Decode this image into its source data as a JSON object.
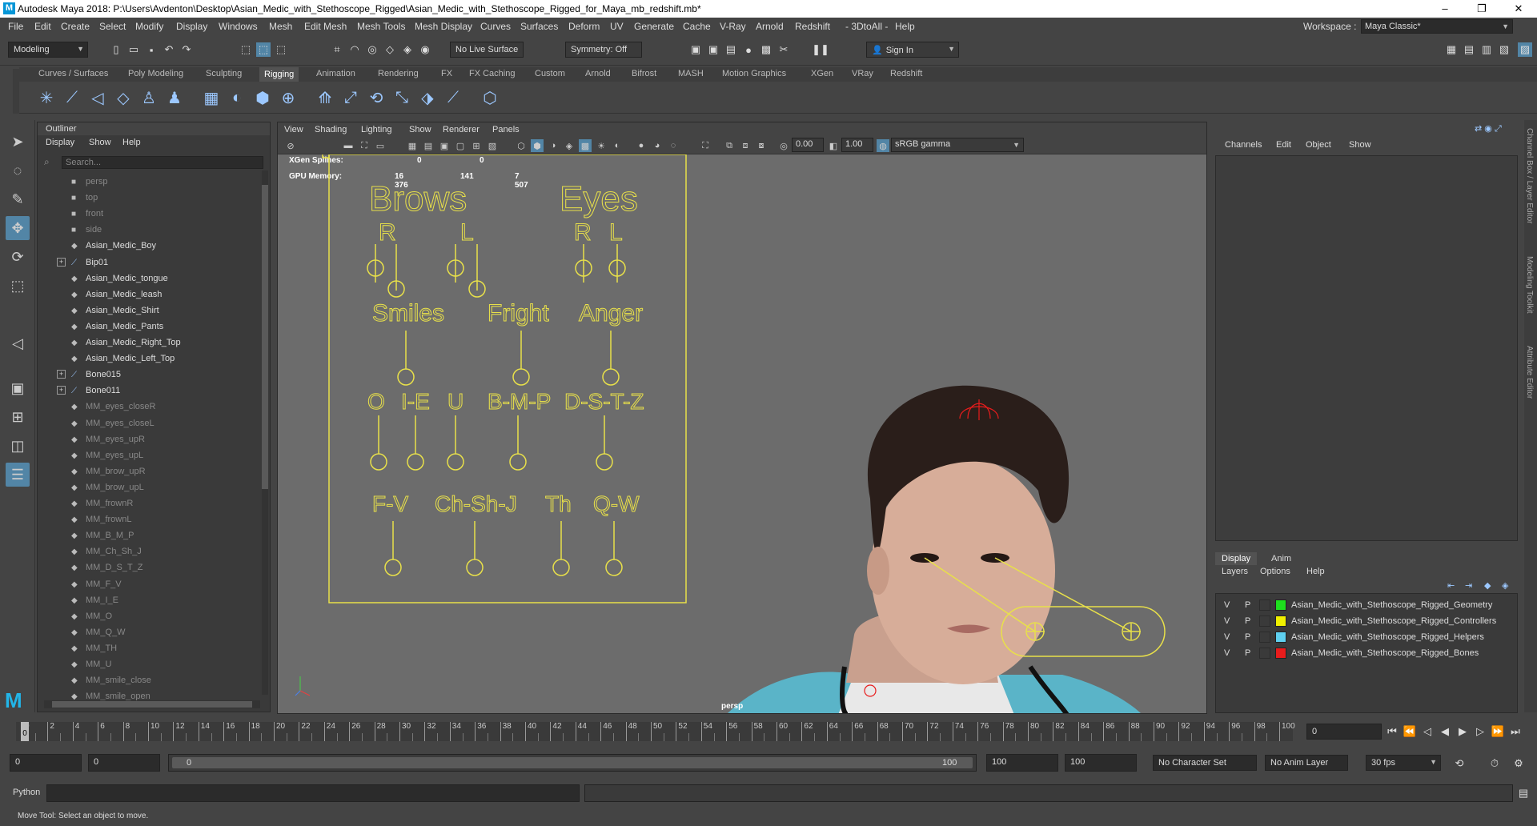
{
  "window": {
    "title": "Autodesk Maya 2018: P:\\Users\\Avdenton\\Desktop\\Asian_Medic_with_Stethoscope_Rigged\\Asian_Medic_with_Stethoscope_Rigged_for_Maya_mb_redshift.mb*",
    "logo": "M",
    "minimize": "–",
    "maximize": "❐",
    "close": "✕"
  },
  "menubar": [
    "File",
    "Edit",
    "Create",
    "Select",
    "Modify",
    "Display",
    "Windows",
    "Mesh",
    "Edit Mesh",
    "Mesh Tools",
    "Mesh Display",
    "Curves",
    "Surfaces",
    "Deform",
    "UV",
    "Generate",
    "Cache",
    "V-Ray",
    "Arnold",
    "Redshift",
    "- 3DtoAll -",
    "Help"
  ],
  "workspace": {
    "label": "Workspace :",
    "value": "Maya Classic*"
  },
  "status": {
    "mode": "Modeling",
    "live_surface": "No Live Surface",
    "symmetry": "Symmetry: Off",
    "sign_in": "Sign In"
  },
  "shelf_tabs": [
    "Curves / Surfaces",
    "Poly Modeling",
    "Sculpting",
    "Rigging",
    "Animation",
    "Rendering",
    "FX",
    "FX Caching",
    "Custom",
    "Arnold",
    "Bifrost",
    "MASH",
    "Motion Graphics",
    "XGen",
    "VRay",
    "Redshift"
  ],
  "shelf_active": "Rigging",
  "outliner": {
    "title": "Outliner",
    "menu": [
      "Display",
      "Show",
      "Help"
    ],
    "search_placeholder": "Search...",
    "items": [
      {
        "label": "persp",
        "icon": "camera-icon",
        "dim": true,
        "exp": false
      },
      {
        "label": "top",
        "icon": "camera-icon",
        "dim": true,
        "exp": false
      },
      {
        "label": "front",
        "icon": "camera-icon",
        "dim": true,
        "exp": false
      },
      {
        "label": "side",
        "icon": "camera-icon",
        "dim": true,
        "exp": false
      },
      {
        "label": "Asian_Medic_Boy",
        "icon": "mesh-icon",
        "dim": false,
        "exp": false
      },
      {
        "label": "Bip01",
        "icon": "joint-icon",
        "dim": false,
        "exp": true
      },
      {
        "label": "Asian_Medic_tongue",
        "icon": "mesh-icon",
        "dim": false,
        "exp": false
      },
      {
        "label": "Asian_Medic_leash",
        "icon": "mesh-icon",
        "dim": false,
        "exp": false
      },
      {
        "label": "Asian_Medic_Shirt",
        "icon": "mesh-icon",
        "dim": false,
        "exp": false
      },
      {
        "label": "Asian_Medic_Pants",
        "icon": "mesh-icon",
        "dim": false,
        "exp": false
      },
      {
        "label": "Asian_Medic_Right_Top",
        "icon": "mesh-icon",
        "dim": false,
        "exp": false
      },
      {
        "label": "Asian_Medic_Left_Top",
        "icon": "mesh-icon",
        "dim": false,
        "exp": false
      },
      {
        "label": "Bone015",
        "icon": "joint-icon",
        "dim": false,
        "exp": true
      },
      {
        "label": "Bone011",
        "icon": "joint-icon",
        "dim": false,
        "exp": true
      },
      {
        "label": "MM_eyes_closeR",
        "icon": "mesh-icon",
        "dim": true,
        "exp": false
      },
      {
        "label": "MM_eyes_closeL",
        "icon": "mesh-icon",
        "dim": true,
        "exp": false
      },
      {
        "label": "MM_eyes_upR",
        "icon": "mesh-icon",
        "dim": true,
        "exp": false
      },
      {
        "label": "MM_eyes_upL",
        "icon": "mesh-icon",
        "dim": true,
        "exp": false
      },
      {
        "label": "MM_brow_upR",
        "icon": "mesh-icon",
        "dim": true,
        "exp": false
      },
      {
        "label": "MM_brow_upL",
        "icon": "mesh-icon",
        "dim": true,
        "exp": false
      },
      {
        "label": "MM_frownR",
        "icon": "mesh-icon",
        "dim": true,
        "exp": false
      },
      {
        "label": "MM_frownL",
        "icon": "mesh-icon",
        "dim": true,
        "exp": false
      },
      {
        "label": "MM_B_M_P",
        "icon": "mesh-icon",
        "dim": true,
        "exp": false
      },
      {
        "label": "MM_Ch_Sh_J",
        "icon": "mesh-icon",
        "dim": true,
        "exp": false
      },
      {
        "label": "MM_D_S_T_Z",
        "icon": "mesh-icon",
        "dim": true,
        "exp": false
      },
      {
        "label": "MM_F_V",
        "icon": "mesh-icon",
        "dim": true,
        "exp": false
      },
      {
        "label": "MM_I_E",
        "icon": "mesh-icon",
        "dim": true,
        "exp": false
      },
      {
        "label": "MM_O",
        "icon": "mesh-icon",
        "dim": true,
        "exp": false
      },
      {
        "label": "MM_Q_W",
        "icon": "mesh-icon",
        "dim": true,
        "exp": false
      },
      {
        "label": "MM_TH",
        "icon": "mesh-icon",
        "dim": true,
        "exp": false
      },
      {
        "label": "MM_U",
        "icon": "mesh-icon",
        "dim": true,
        "exp": false
      },
      {
        "label": "MM_smile_close",
        "icon": "mesh-icon",
        "dim": true,
        "exp": false
      },
      {
        "label": "MM_smile_open",
        "icon": "mesh-icon",
        "dim": true,
        "exp": false
      }
    ]
  },
  "viewport": {
    "menu": [
      "View",
      "Shading",
      "Lighting",
      "Show",
      "Renderer",
      "Panels"
    ],
    "exposure": "0.00",
    "gamma": "1.00",
    "colorspace": "sRGB gamma",
    "hud": {
      "xgen_label": "XGen Splines:",
      "xgen_values": [
        "0",
        "0"
      ],
      "gpu_label": "GPU Memory:",
      "gpu_values": [
        "16 376",
        "141",
        "7 507"
      ]
    },
    "camera_label": "persp",
    "face_board": {
      "brows": "Brows",
      "eyes": "Eyes",
      "r": "R",
      "l": "L",
      "smiles": "Smiles",
      "fright": "Fright",
      "anger": "Anger",
      "o": "O",
      "ie": "I-E",
      "u": "U",
      "bmp": "B-M-P",
      "dstz": "D-S-T-Z",
      "fv": "F-V",
      "chshj": "Ch-Sh-J",
      "th": "Th",
      "qw": "Q-W"
    },
    "rig_color": "#e8e04a"
  },
  "channelbox": {
    "menu": [
      "Channels",
      "Edit",
      "Object",
      "Show"
    ],
    "layer_tabs": [
      "Display",
      "Anim"
    ],
    "layer_menu": [
      "Layers",
      "Options",
      "Help"
    ],
    "layers": [
      {
        "v": "V",
        "p": "P",
        "color": "#1ee01e",
        "name": "Asian_Medic_with_Stethoscope_Rigged_Geometry"
      },
      {
        "v": "V",
        "p": "P",
        "color": "#f0f000",
        "name": "Asian_Medic_with_Stethoscope_Rigged_Controllers"
      },
      {
        "v": "V",
        "p": "P",
        "color": "#5fd0f0",
        "name": "Asian_Medic_with_Stethoscope_Rigged_Helpers"
      },
      {
        "v": "V",
        "p": "P",
        "color": "#e81c1c",
        "name": "Asian_Medic_with_Stethoscope_Rigged_Bones"
      }
    ]
  },
  "side_tabs": [
    "Channel Box / Layer Editor",
    "Modeling Toolkit",
    "Attribute Editor"
  ],
  "timeline": {
    "ticks": [
      0,
      2,
      4,
      6,
      8,
      10,
      12,
      14,
      16,
      18,
      20,
      22,
      24,
      26,
      28,
      30,
      32,
      34,
      36,
      38,
      40,
      42,
      44,
      46,
      48,
      50,
      52,
      54,
      56,
      58,
      60,
      62,
      64,
      66,
      68,
      70,
      72,
      74,
      76,
      78,
      80,
      82,
      84,
      86,
      88,
      90,
      92,
      94,
      96,
      98,
      100
    ],
    "current_frame": "0",
    "current_field": "0"
  },
  "range": {
    "start": "0",
    "start2": "0",
    "slider_start": "0",
    "slider_end": "100",
    "end": "100",
    "end2": "100",
    "character_set": "No Character Set",
    "anim_layer": "No Anim Layer",
    "fps": "30 fps"
  },
  "cmdline": {
    "lang": "Python"
  },
  "helpline": "Move Tool: Select an object to move."
}
